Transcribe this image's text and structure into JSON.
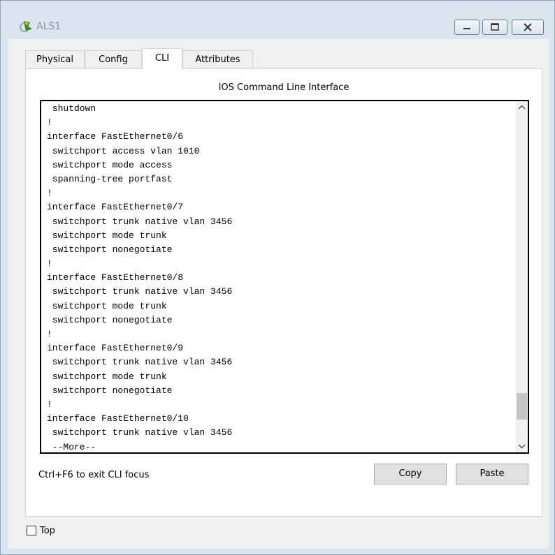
{
  "window": {
    "title": "ALS1",
    "colors": {
      "titlebar_bg": "#dbe5f0",
      "close_accent": "#c9d6e6"
    }
  },
  "tabs": [
    {
      "label": "Physical",
      "active": false
    },
    {
      "label": "Config",
      "active": false
    },
    {
      "label": "CLI",
      "active": true
    },
    {
      "label": "Attributes",
      "active": false
    }
  ],
  "cli": {
    "panel_title": "IOS Command Line Interface",
    "lines": [
      " shutdown",
      "!",
      "interface FastEthernet0/6",
      " switchport access vlan 1010",
      " switchport mode access",
      " spanning-tree portfast",
      "!",
      "interface FastEthernet0/7",
      " switchport trunk native vlan 3456",
      " switchport mode trunk",
      " switchport nonegotiate",
      "!",
      "interface FastEthernet0/8",
      " switchport trunk native vlan 3456",
      " switchport mode trunk",
      " switchport nonegotiate",
      "!",
      "interface FastEthernet0/9",
      " switchport trunk native vlan 3456",
      " switchport mode trunk",
      " switchport nonegotiate",
      "!",
      "interface FastEthernet0/10",
      " switchport trunk native vlan 3456",
      " --More--"
    ],
    "scroll_position": 0.93
  },
  "footer": {
    "hint": "Ctrl+F6 to exit CLI focus",
    "copy_label": "Copy",
    "paste_label": "Paste"
  },
  "top_checkbox": {
    "label": "Top",
    "checked": false
  }
}
